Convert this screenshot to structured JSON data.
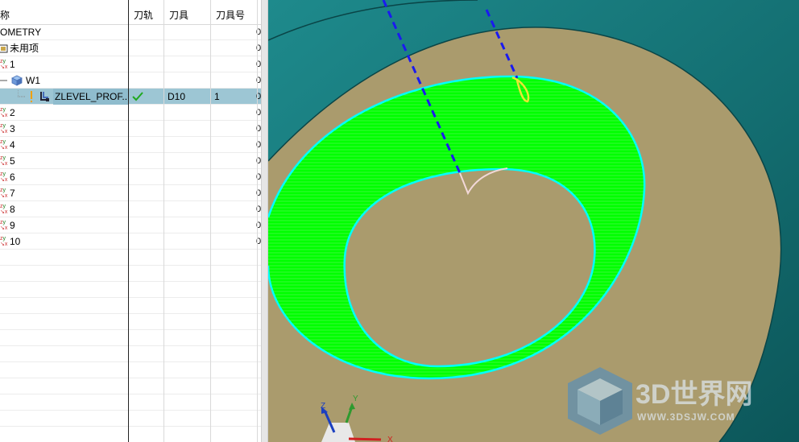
{
  "navigator": {
    "columns": {
      "name": "称",
      "toolpath": "刀轨",
      "tool": "刀具",
      "tool_number": "刀具号"
    },
    "rows": [
      {
        "name": "OMETRY",
        "edge": "0"
      },
      {
        "name": "未用项",
        "edge": "0"
      },
      {
        "name": "1",
        "edge": "0"
      },
      {
        "name": "W1",
        "edge": "0"
      },
      {
        "name": "ZLEVEL_PROF...",
        "status": "✓",
        "tool": "D10",
        "tool_number": "1",
        "edge": "0"
      },
      {
        "name": "2",
        "edge": "0"
      },
      {
        "name": "3",
        "edge": "0"
      },
      {
        "name": "4",
        "edge": "0"
      },
      {
        "name": "5",
        "edge": "0"
      },
      {
        "name": "6",
        "edge": "0"
      },
      {
        "name": "7",
        "edge": "0"
      },
      {
        "name": "8",
        "edge": "0"
      },
      {
        "name": "9",
        "edge": "0"
      },
      {
        "name": "10",
        "edge": "0"
      }
    ]
  },
  "viewport": {
    "triad_labels": {
      "z": "Z",
      "y": "Y",
      "x": "X"
    },
    "watermark": {
      "brand": "3D世界网",
      "url": "WWW.3DSJW.COM"
    },
    "colors": {
      "floor": "#aa9b6d",
      "outer_wall": "#1d7f80",
      "toolpath": "#00ff00",
      "boundary": "#00ffff",
      "approach_line": "#1a1af0",
      "engage_arc": "#e8e832",
      "retract": "#f2d8d8"
    }
  }
}
